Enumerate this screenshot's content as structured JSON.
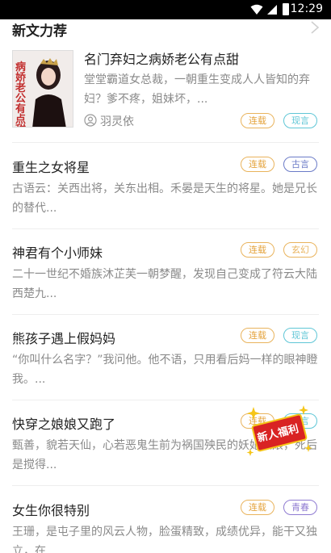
{
  "status_bar": {
    "time": "12:29"
  },
  "section": {
    "title": "新文力荐"
  },
  "featured": {
    "title": "名门弃妇之病娇老公有点甜",
    "desc": "堂堂霸道女总裁，一朝重生变成人人皆知的弃妇？爹不疼，姐妹坏，...",
    "author": "羽灵依",
    "status": "连载",
    "category": "现言",
    "category_color": "#5fc6d6",
    "cover_text": "病娇老公有点甜"
  },
  "books": [
    {
      "title": "重生之女将星",
      "desc": "古语云：关西出将，关东出相。禾晏是天生的将星。她是兄长的替代...",
      "status": "连载",
      "category": "古言",
      "category_color": "#6b7bc7"
    },
    {
      "title": "神君有个小师妹",
      "desc": "二十一世纪不婚族沐芷芙一朝梦醒，发现自己变成了符云大陆西楚九...",
      "status": "连载",
      "category": "玄幻",
      "category_color": "#e9b35c"
    },
    {
      "title": "熊孩子遇上假妈妈",
      "desc": "“你叫什么名字？”我问他。他不语，只用看后妈一样的眼神瞪我。...",
      "status": "连载",
      "category": "现言",
      "category_color": "#5fc6d6"
    },
    {
      "title": "快穿之娘娘又跑了",
      "desc": "甄善，貌若天仙，心若恶鬼生前为祸国殃民的妖妃娘娘，死后是搅得...",
      "status": "连载",
      "category": "现言",
      "category_color": "#5fc6d6"
    },
    {
      "title": "女生你很特别",
      "desc": "王珊，是屯子里的风云人物，脸蛋精致，成绩优异，能干又独立，在...",
      "status": "连载",
      "category": "青春",
      "category_color": "#8e7ad1"
    }
  ],
  "promo": {
    "label": "新人福利"
  }
}
